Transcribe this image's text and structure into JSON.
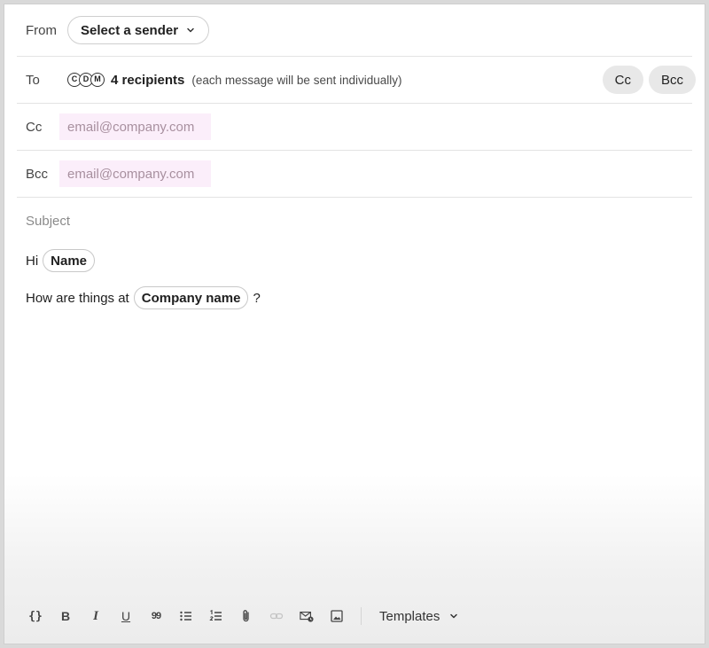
{
  "from": {
    "label": "From",
    "select_value": "Select a sender"
  },
  "to": {
    "label": "To",
    "avatar_initials": [
      "C",
      "D",
      "M"
    ],
    "recipients_count": "4 recipients",
    "recipients_note": "(each message will be sent individually)",
    "cc_button": "Cc",
    "bcc_button": "Bcc"
  },
  "cc": {
    "label": "Cc",
    "placeholder": "email@company.com"
  },
  "bcc": {
    "label": "Bcc",
    "placeholder": "email@company.com"
  },
  "message": {
    "subject_placeholder": "Subject",
    "greeting": "Hi",
    "name_variable": "Name",
    "question_prefix": "How are things at",
    "company_variable": "Company name",
    "question_suffix": "?"
  },
  "toolbar": {
    "icons": [
      "variables-icon",
      "bold-icon",
      "italic-icon",
      "underline-icon",
      "quote-icon",
      "bullet-list-icon",
      "numbered-list-icon",
      "attachment-icon",
      "link-icon",
      "email-schedule-icon",
      "image-icon"
    ],
    "bold_glyph": "B",
    "italic_glyph": "I",
    "underline_glyph": "U",
    "quote_glyph": "99",
    "variables_glyph": "{}",
    "templates_label": "Templates"
  },
  "colors": {
    "input_highlight": "#fbeefa",
    "pill_background": "#e8e8e8"
  }
}
